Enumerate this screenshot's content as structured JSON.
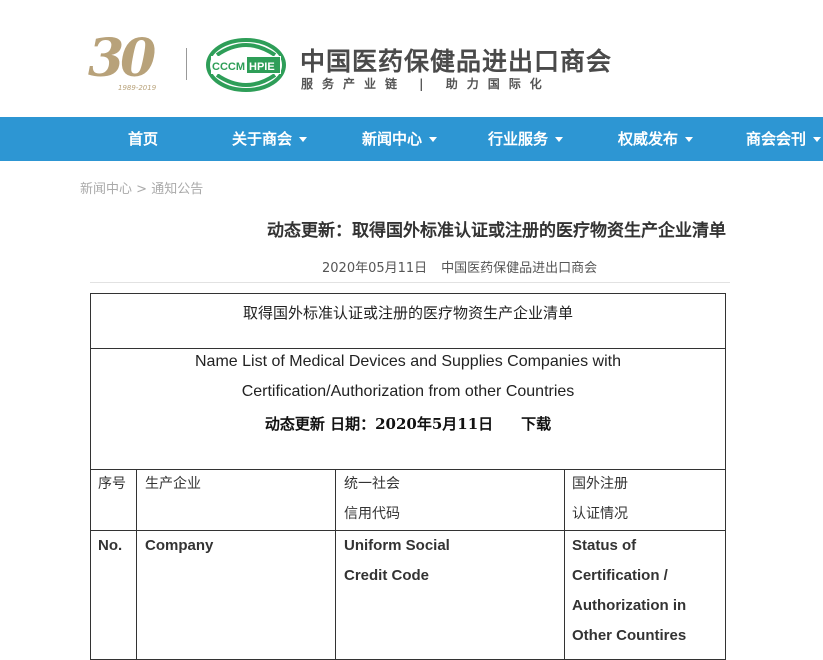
{
  "header": {
    "anniv_number": "30",
    "anniv_years": "1989-2019",
    "emblem_left": "CCCM",
    "emblem_right": "HPIE",
    "org_name": "中国医药保健品进出口商会",
    "slogan": "服务产业链 | 助力国际化"
  },
  "nav": {
    "items": [
      {
        "label": "首页",
        "dropdown": false
      },
      {
        "label": "关于商会",
        "dropdown": true
      },
      {
        "label": "新闻中心",
        "dropdown": true
      },
      {
        "label": "行业服务",
        "dropdown": true
      },
      {
        "label": "权威发布",
        "dropdown": true
      },
      {
        "label": "商会会刊",
        "dropdown": true
      }
    ]
  },
  "breadcrumb": {
    "root": "新闻中心",
    "sep": ">",
    "current": "通知公告"
  },
  "article": {
    "title": "动态更新：取得国外标准认证或注册的医疗物资生产企业清单",
    "date": "2020年05月11日",
    "source": "中国医药保健品进出口商会"
  },
  "table": {
    "title_cn": "取得国外标准认证或注册的医疗物资生产企业清单",
    "title_en_1": "Name List of Medical Devices and Supplies Companies with",
    "title_en_2": "Certification/Authorization from other Countries",
    "dynamic": "动态更新  日期：2020年5月11日",
    "download": "下载",
    "headers_cn": {
      "no": "序号",
      "company": "生产企业",
      "credit_1": "统一社会",
      "credit_2": "信用代码",
      "status_1": "国外注册",
      "status_2": "认证情况"
    },
    "headers_en": {
      "no": "No.",
      "company": "Company",
      "credit_1": "Uniform Social",
      "credit_2": "Credit Code",
      "status_1": "Status of",
      "status_2": "Certification /",
      "status_3": "Authorization in",
      "status_4": "Other Countires"
    }
  },
  "colors": {
    "nav_bg": "#2d96d3",
    "emblem_green": "#2e9e58",
    "anniv_gold": "#b8a27a"
  }
}
